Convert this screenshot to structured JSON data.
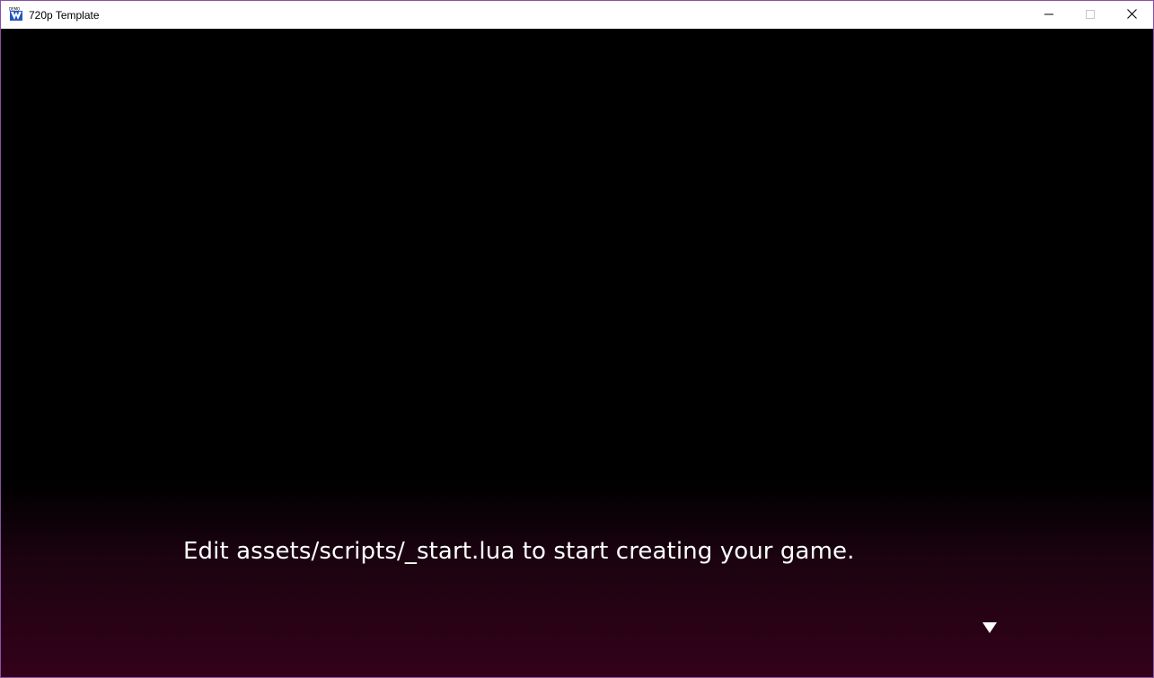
{
  "window": {
    "title": "720p Template",
    "icon": "app-logo-icon",
    "controls": {
      "minimize": "minimize-icon",
      "maximize": "maximize-icon",
      "close": "close-icon"
    }
  },
  "game": {
    "dialog_text": "Edit assets/scripts/_start.lua to start creating your game.",
    "advance_indicator": "triangle-down-icon"
  },
  "colors": {
    "window_border": "#8b4ea8",
    "gradient_bottom": "#33021a",
    "text": "#ffffff"
  }
}
